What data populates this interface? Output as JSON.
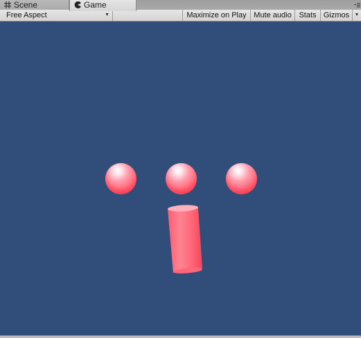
{
  "tabs": [
    {
      "label": "Scene",
      "icon": "grid-icon",
      "active": false
    },
    {
      "label": "Game",
      "icon": "pacman-icon",
      "active": true
    }
  ],
  "toolbar": {
    "aspect_label": "Free Aspect",
    "maximize_label": "Maximize on Play",
    "mute_label": "Mute audio",
    "stats_label": "Stats",
    "gizmos_label": "Gizmos"
  },
  "scene": {
    "background_color": "#314d79",
    "object_color": "#ff5c6e",
    "objects": [
      "sphere",
      "sphere",
      "sphere",
      "cylinder"
    ]
  }
}
